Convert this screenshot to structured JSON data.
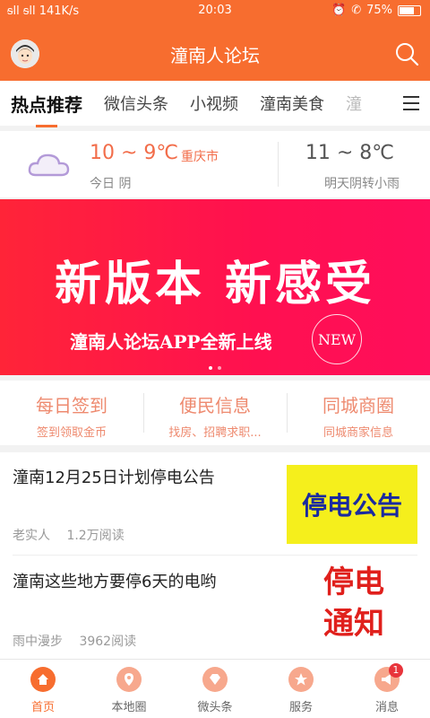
{
  "status_bar": {
    "signal": "ᵴll ᵴll 141K/s",
    "time": "20:03",
    "battery_text": "75%",
    "battery_level": 0.75
  },
  "header": {
    "title": "潼南人论坛"
  },
  "tabs": [
    "热点推荐",
    "微信头条",
    "小视频",
    "潼南美食",
    "潼"
  ],
  "weather": {
    "today_temp": "10 ~ 9℃",
    "city": "重庆市",
    "today_label": "今日 阴",
    "tomorrow_temp": "11 ~ 8℃",
    "tomorrow_label": "明天阴转小雨"
  },
  "banner": {
    "headline": "新版本 新感受",
    "subline": "潼南人论坛APP全新上线",
    "badge": "NEW",
    "slide_count": 2,
    "active_slide": 1
  },
  "quick_links": [
    {
      "title": "每日签到",
      "subtitle": "签到领取金币"
    },
    {
      "title": "便民信息",
      "subtitle": "找房、招聘求职..."
    },
    {
      "title": "同城商圈",
      "subtitle": "同城商家信息"
    }
  ],
  "news": [
    {
      "title": "潼南12月25日计划停电公告",
      "author": "老实人",
      "reads": "1.2万阅读",
      "thumb_text": "停电公告"
    },
    {
      "title": "潼南这些地方要停6天的电哟",
      "author": "雨中漫步",
      "reads": "3962阅读",
      "thumb_text_line1": "停电",
      "thumb_text_line2": "通知"
    }
  ],
  "bottom_nav": [
    {
      "label": "首页",
      "icon": "home-icon"
    },
    {
      "label": "本地圈",
      "icon": "location-icon"
    },
    {
      "label": "微头条",
      "icon": "diamond-icon"
    },
    {
      "label": "服务",
      "icon": "star-icon"
    },
    {
      "label": "消息",
      "icon": "megaphone-icon",
      "badge": "1"
    }
  ],
  "colors": {
    "brand": "#f76d2f",
    "accent_red": "#f26d4a",
    "banner": "#ff1050"
  }
}
